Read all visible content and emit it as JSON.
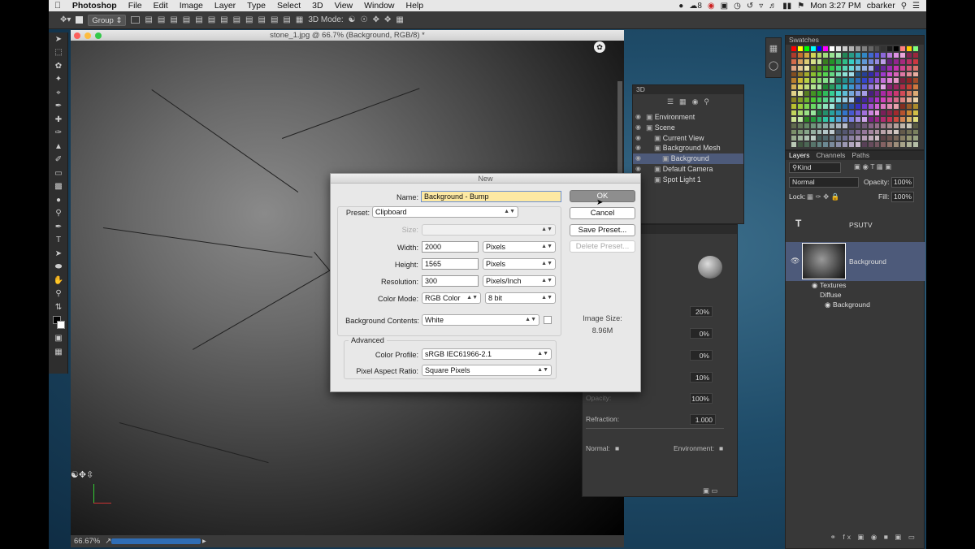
{
  "menubar": {
    "items": [
      "Photoshop",
      "File",
      "Edit",
      "Image",
      "Layer",
      "Type",
      "Select",
      "3D",
      "View",
      "Window",
      "Help"
    ],
    "right": {
      "badge": "8",
      "clock": "Mon 3:27 PM",
      "user": "cbarker"
    }
  },
  "optbar": {
    "group_select": "Group",
    "mode_label": "3D Mode:"
  },
  "document": {
    "title": "stone_1.jpg @ 66.7% (Background, RGB/8) *",
    "zoom": "66.67%"
  },
  "panel3d": {
    "tab": "3D",
    "items": [
      {
        "label": "Environment",
        "indent": 0,
        "selected": false
      },
      {
        "label": "Scene",
        "indent": 0,
        "selected": false
      },
      {
        "label": "Current View",
        "indent": 1,
        "selected": false
      },
      {
        "label": "Background Mesh",
        "indent": 1,
        "selected": false
      },
      {
        "label": "Background",
        "indent": 2,
        "selected": true
      },
      {
        "label": "Default Camera",
        "indent": 1,
        "selected": false
      },
      {
        "label": "Spot Light 1",
        "indent": 1,
        "selected": false
      }
    ]
  },
  "properties": {
    "values": [
      "20%",
      "0%",
      "0%",
      "10%",
      "100%"
    ],
    "opacity_label": "Opacity:",
    "refraction_label": "Refraction:",
    "refraction_value": "1.000",
    "normal_label": "Normal:",
    "environment_label": "Environment:"
  },
  "dialog": {
    "title": "New",
    "name_label": "Name:",
    "name_value": "Background - Bump",
    "preset_label": "Preset:",
    "preset_value": "Clipboard",
    "size_label": "Size:",
    "width_label": "Width:",
    "width_value": "2000",
    "width_unit": "Pixels",
    "height_label": "Height:",
    "height_value": "1565",
    "height_unit": "Pixels",
    "resolution_label": "Resolution:",
    "resolution_value": "300",
    "resolution_unit": "Pixels/Inch",
    "colormode_label": "Color Mode:",
    "colormode_value": "RGB Color",
    "bitdepth_value": "8 bit",
    "bg_label": "Background Contents:",
    "bg_value": "White",
    "advanced_label": "Advanced",
    "profile_label": "Color Profile:",
    "profile_value": "sRGB IEC61966-2.1",
    "par_label": "Pixel Aspect Ratio:",
    "par_value": "Square Pixels",
    "buttons": {
      "ok": "OK",
      "cancel": "Cancel",
      "save_preset": "Save Preset...",
      "delete_preset": "Delete Preset..."
    },
    "image_size_label": "Image Size:",
    "image_size_value": "8.96M"
  },
  "swatches": {
    "tab": "Swatches"
  },
  "layers": {
    "tabs": [
      "Layers",
      "Channels",
      "Paths"
    ],
    "kind_filter": "Kind",
    "blend_mode": "Normal",
    "opacity_label": "Opacity:",
    "opacity_value": "100%",
    "lock_label": "Lock:",
    "fill_label": "Fill:",
    "fill_value": "100%",
    "rows": {
      "type_layer": "PSUTV",
      "bg_layer": "Background",
      "textures": "Textures",
      "diffuse": "Diffuse",
      "bg_sub": "Background"
    }
  }
}
